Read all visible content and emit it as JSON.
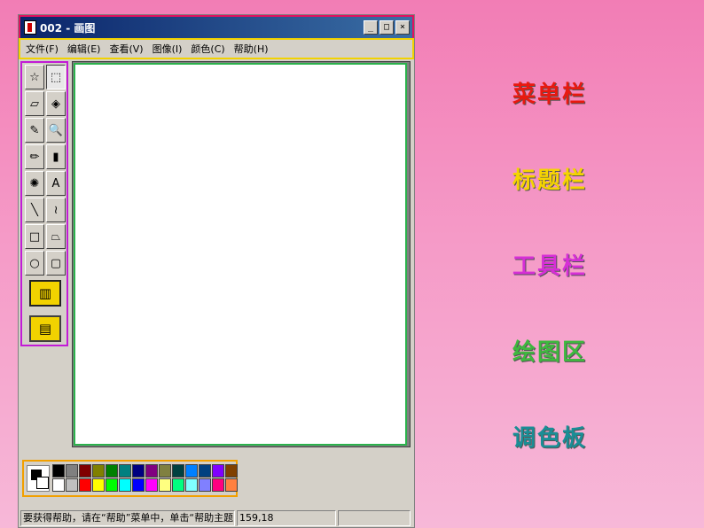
{
  "window": {
    "title": "002 - 画图",
    "buttons": [
      "_",
      "□",
      "×"
    ]
  },
  "menu": [
    "文件(F)",
    "编辑(E)",
    "查看(V)",
    "图像(I)",
    "颜色(C)",
    "帮助(H)"
  ],
  "tools": [
    {
      "name": "free-select-icon",
      "glyph": "☆"
    },
    {
      "name": "rect-select-icon",
      "glyph": "⬚"
    },
    {
      "name": "eraser-icon",
      "glyph": "▱"
    },
    {
      "name": "fill-icon",
      "glyph": "◈"
    },
    {
      "name": "color-picker-icon",
      "glyph": "✎"
    },
    {
      "name": "magnifier-icon",
      "glyph": "🔍"
    },
    {
      "name": "pencil-icon",
      "glyph": "✏"
    },
    {
      "name": "brush-icon",
      "glyph": "▮"
    },
    {
      "name": "airbrush-icon",
      "glyph": "✺"
    },
    {
      "name": "text-icon",
      "glyph": "A"
    },
    {
      "name": "line-icon",
      "glyph": "╲"
    },
    {
      "name": "curve-icon",
      "glyph": "≀"
    },
    {
      "name": "rectangle-icon",
      "glyph": "□"
    },
    {
      "name": "polygon-icon",
      "glyph": "⏢"
    },
    {
      "name": "ellipse-icon",
      "glyph": "○"
    },
    {
      "name": "rounded-rect-icon",
      "glyph": "▢"
    }
  ],
  "palette": {
    "top": [
      "#000000",
      "#808080",
      "#800000",
      "#808000",
      "#008000",
      "#008080",
      "#000080",
      "#800080",
      "#808040",
      "#004040",
      "#0080ff",
      "#004080",
      "#8000ff",
      "#804000"
    ],
    "bottom": [
      "#ffffff",
      "#c0c0c0",
      "#ff0000",
      "#ffff00",
      "#00ff00",
      "#00ffff",
      "#0000ff",
      "#ff00ff",
      "#ffff80",
      "#00ff80",
      "#80ffff",
      "#8080ff",
      "#ff0080",
      "#ff8040"
    ]
  },
  "status": {
    "help_text": "要获得帮助，请在“帮助”菜单中，单击“帮助主题”",
    "coords": "159,18"
  },
  "labels": [
    {
      "text": "菜单栏",
      "color": "#e8190f"
    },
    {
      "text": "标题栏",
      "color": "#f5d400"
    },
    {
      "text": "工具栏",
      "color": "#d62fd6"
    },
    {
      "text": "绘图区",
      "color": "#3fb83f"
    },
    {
      "text": "调色板",
      "color": "#1a8e96"
    }
  ]
}
